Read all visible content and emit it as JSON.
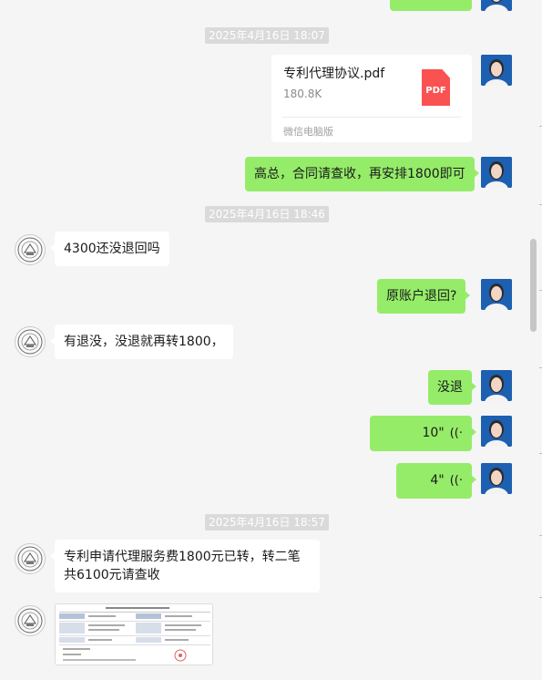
{
  "timestamps": [
    "2025年4月16日 18:07",
    "2025年4月16日 18:46",
    "2025年4月16日 18:57"
  ],
  "file_card": {
    "name": "专利代理协议.pdf",
    "size": "180.8K",
    "icon_label": "PDF",
    "source": "微信电脑版"
  },
  "messages": {
    "m1": "高总，合同请查收，再安排1800即可",
    "m2": "4300还没退回吗",
    "m3": "原账户退回?",
    "m4": "有退没，没退就再转1800，",
    "m5": "没退",
    "voice1": "10\"",
    "voice2": "4\"",
    "m6": "专利申请代理服务费1800元已转，转二笔共6100元请查收"
  },
  "colors": {
    "my_bubble": "#95ec69",
    "other_bubble": "#ffffff",
    "background": "#f5f5f5",
    "pdf_icon": "#fa5151"
  }
}
